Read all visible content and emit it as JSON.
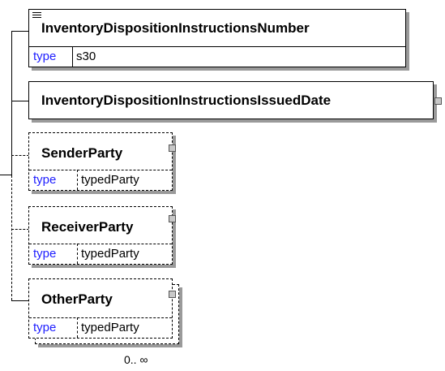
{
  "elements": [
    {
      "name": "InventoryDispositionInstructionsNumber",
      "type_label": "type",
      "type_value": "s30",
      "optional": false
    },
    {
      "name": "InventoryDispositionInstructionsIssuedDate",
      "optional": false
    },
    {
      "name": "SenderParty",
      "type_label": "type",
      "type_value": "typedParty",
      "optional": true
    },
    {
      "name": "ReceiverParty",
      "type_label": "type",
      "type_value": "typedParty",
      "optional": true
    },
    {
      "name": "OtherParty",
      "type_label": "type",
      "type_value": "typedParty",
      "optional": true,
      "multiple": true
    }
  ],
  "cardinality": "0.. ∞",
  "colors": {
    "type_label": "#2020ff",
    "shadow": "#9a9a9a",
    "connector_fill": "#c8c8c8"
  },
  "icons": {
    "documentation": "documentation-lines-icon",
    "child_connector": "child-connector-icon"
  }
}
